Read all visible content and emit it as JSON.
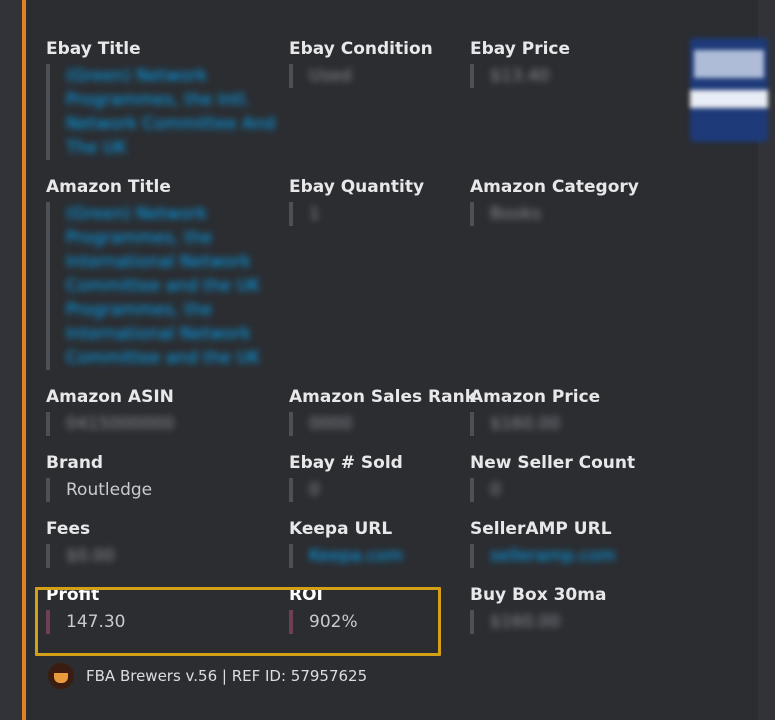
{
  "embed": {
    "accent_color": "#e67e22",
    "rows": [
      {
        "fields": [
          {
            "name": "Ebay Title",
            "value": "(Green) Network Programmes, the Intl. Network Committee And The UK",
            "blurred": true,
            "link": true
          },
          {
            "name": "Ebay Condition",
            "value": "Used",
            "blurred": true
          },
          {
            "name": "Ebay Price",
            "value": "$13.40",
            "blurred": true
          }
        ]
      },
      {
        "fields": [
          {
            "name": "Amazon Title",
            "value": "(Green) Network Programmes, the International Network Committee and the UK Programmes, the International Network Committee and the UK",
            "blurred": true,
            "link": true
          },
          {
            "name": "Ebay Quantity",
            "value": "1",
            "blurred": true
          },
          {
            "name": "Amazon Category",
            "value": "Books",
            "blurred": true
          }
        ]
      },
      {
        "fields": [
          {
            "name": "Amazon ASIN",
            "value": "0415000000",
            "blurred": true
          },
          {
            "name": "Amazon Sales Rank",
            "value": "0000",
            "blurred": true
          },
          {
            "name": "Amazon Price",
            "value": "$160.00",
            "blurred": true
          }
        ]
      },
      {
        "fields": [
          {
            "name": "Brand",
            "value": "Routledge",
            "blurred": false
          },
          {
            "name": "Ebay # Sold",
            "value": "0",
            "blurred": true
          },
          {
            "name": "New Seller Count",
            "value": "0",
            "blurred": true
          }
        ]
      },
      {
        "fields": [
          {
            "name": "Fees",
            "value": "$0.00",
            "blurred": true
          },
          {
            "name": "Keepa URL",
            "value": "Keepa.com",
            "blurred": true,
            "link": true
          },
          {
            "name": "SellerAMP URL",
            "value": "selleramp.com",
            "blurred": true,
            "link": true
          }
        ]
      },
      {
        "fields": [
          {
            "name": "Profit",
            "value": "147.30",
            "blurred": false,
            "highlighted": true
          },
          {
            "name": "ROI",
            "value": "902%",
            "blurred": false,
            "highlighted": true
          },
          {
            "name": "Buy Box 30ma",
            "value": "$160.00",
            "blurred": true
          }
        ]
      }
    ],
    "footer": {
      "text": "FBA Brewers v.56 | REF ID: 57957625"
    }
  }
}
